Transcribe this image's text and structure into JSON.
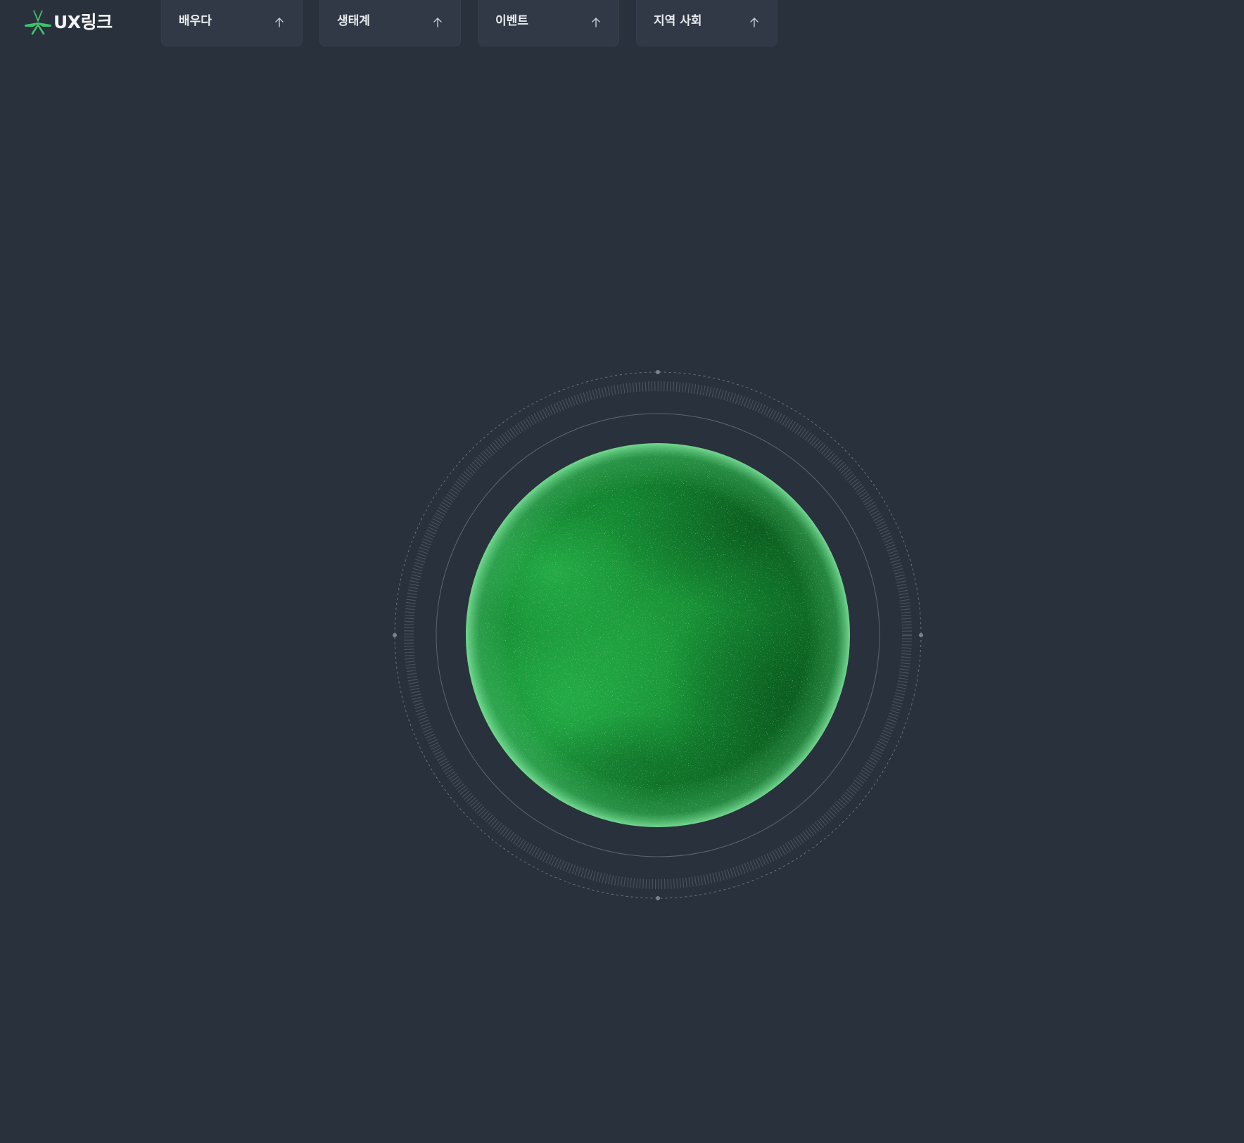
{
  "brand": {
    "name": "UX링크",
    "logo_icon": "asterisk-leaf-logo-icon",
    "accent_color": "#3fc46b"
  },
  "nav": {
    "items": [
      {
        "label": "배우다",
        "icon": "arrow-up-icon"
      },
      {
        "label": "생태계",
        "icon": "arrow-up-icon"
      },
      {
        "label": "이벤트",
        "icon": "arrow-up-icon"
      },
      {
        "label": "지역 사회",
        "icon": "arrow-up-icon"
      }
    ]
  },
  "hero": {
    "visual": "green-planet-with-orbit-rings",
    "planet_color": "#1a9a3a",
    "background_color": "#29313c"
  }
}
